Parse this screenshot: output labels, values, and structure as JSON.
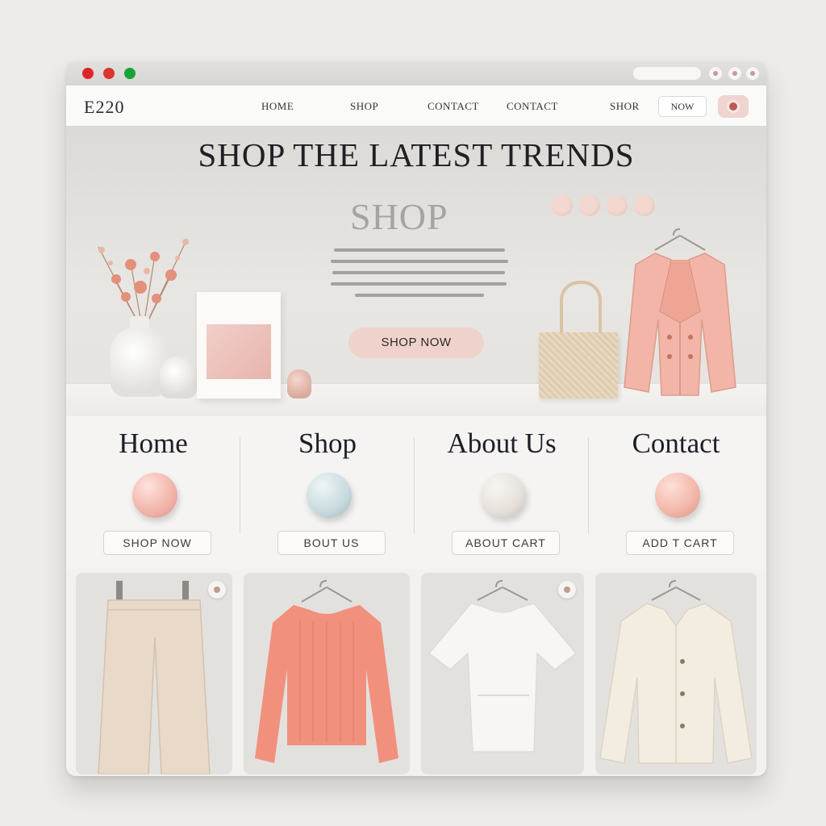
{
  "window": {
    "url_text": "",
    "controls": [
      "minimize",
      "maximize",
      "close"
    ]
  },
  "navbar": {
    "brand": "E220",
    "links": [
      "HOME",
      "SHOP",
      "CONTACT",
      "CONTACT",
      "SHOR"
    ],
    "now_button": "NOW",
    "cart_icon": "cart-icon"
  },
  "hero": {
    "title": "SHOP THE LATEST TRENDS",
    "subtitle": "SHOP",
    "cta": "SHOP NOW"
  },
  "nav_cards": [
    {
      "heading": "Home",
      "button": "SHOP NOW",
      "orb_color": "#f1b3a8"
    },
    {
      "heading": "Shop",
      "button": "BOUT US",
      "orb_color": "#c8dade"
    },
    {
      "heading": "About Us",
      "button": "ABOUT CART",
      "orb_color": "#e5e0da"
    },
    {
      "heading": "Contact",
      "button": "ADD T CART",
      "orb_color": "#f2b6a8"
    }
  ],
  "products": [
    {
      "name": "wide-leg-trousers",
      "color": "#e8d9c8"
    },
    {
      "name": "knit-sweater",
      "color": "#f2907e"
    },
    {
      "name": "white-tshirt",
      "color": "#f7f6f3"
    },
    {
      "name": "cream-blazer",
      "color": "#f3ece1"
    }
  ],
  "colors": {
    "accent_pink": "#f0d2cc",
    "background": "#f3f2f0",
    "text_dark": "#1f1f24"
  }
}
